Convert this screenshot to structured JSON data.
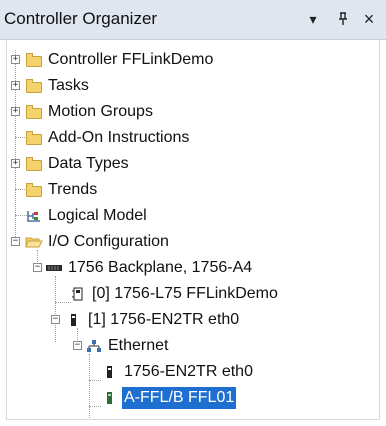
{
  "panel": {
    "title": "Controller Organizer",
    "buttons": {
      "dropdown": "▾",
      "pin": "ᵖ",
      "close": "×"
    }
  },
  "tree": [
    {
      "label": "Controller FFLinkDemo",
      "icon": "folder-icon",
      "expander": "+"
    },
    {
      "label": "Tasks",
      "icon": "folder-icon",
      "expander": "+"
    },
    {
      "label": "Motion Groups",
      "icon": "folder-icon",
      "expander": "+"
    },
    {
      "label": "Add-On Instructions",
      "icon": "folder-icon"
    },
    {
      "label": "Data Types",
      "icon": "folder-icon",
      "expander": "+"
    },
    {
      "label": "Trends",
      "icon": "folder-icon"
    },
    {
      "label": "Logical Model",
      "icon": "logical-model-icon"
    },
    {
      "label": "I/O Configuration",
      "icon": "open-folder-icon",
      "expander": "−"
    },
    {
      "label": "1756 Backplane, 1756-A4",
      "icon": "backplane-icon",
      "expander": "−"
    },
    {
      "label": "[0] 1756-L75 FFLinkDemo",
      "icon": "controller-module-icon"
    },
    {
      "label": "[1] 1756-EN2TR eth0",
      "icon": "module-icon",
      "expander": "−"
    },
    {
      "label": "Ethernet",
      "icon": "network-icon",
      "expander": "−"
    },
    {
      "label": "1756-EN2TR eth0",
      "icon": "module-icon"
    },
    {
      "label": "A-FFL/B FFL01",
      "icon": "device-icon",
      "selected": true
    }
  ]
}
